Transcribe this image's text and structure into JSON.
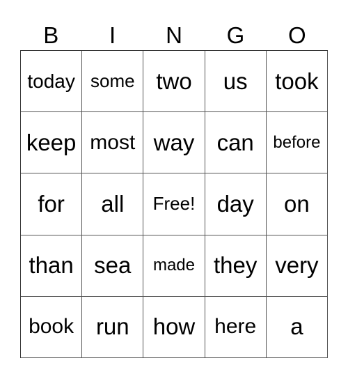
{
  "header": [
    "B",
    "I",
    "N",
    "G",
    "O"
  ],
  "cells": [
    [
      "today",
      "some",
      "two",
      "us",
      "took"
    ],
    [
      "keep",
      "most",
      "way",
      "can",
      "before"
    ],
    [
      "for",
      "all",
      "Free!",
      "day",
      "on"
    ],
    [
      "than",
      "sea",
      "made",
      "they",
      "very"
    ],
    [
      "book",
      "run",
      "how",
      "here",
      "a"
    ]
  ]
}
